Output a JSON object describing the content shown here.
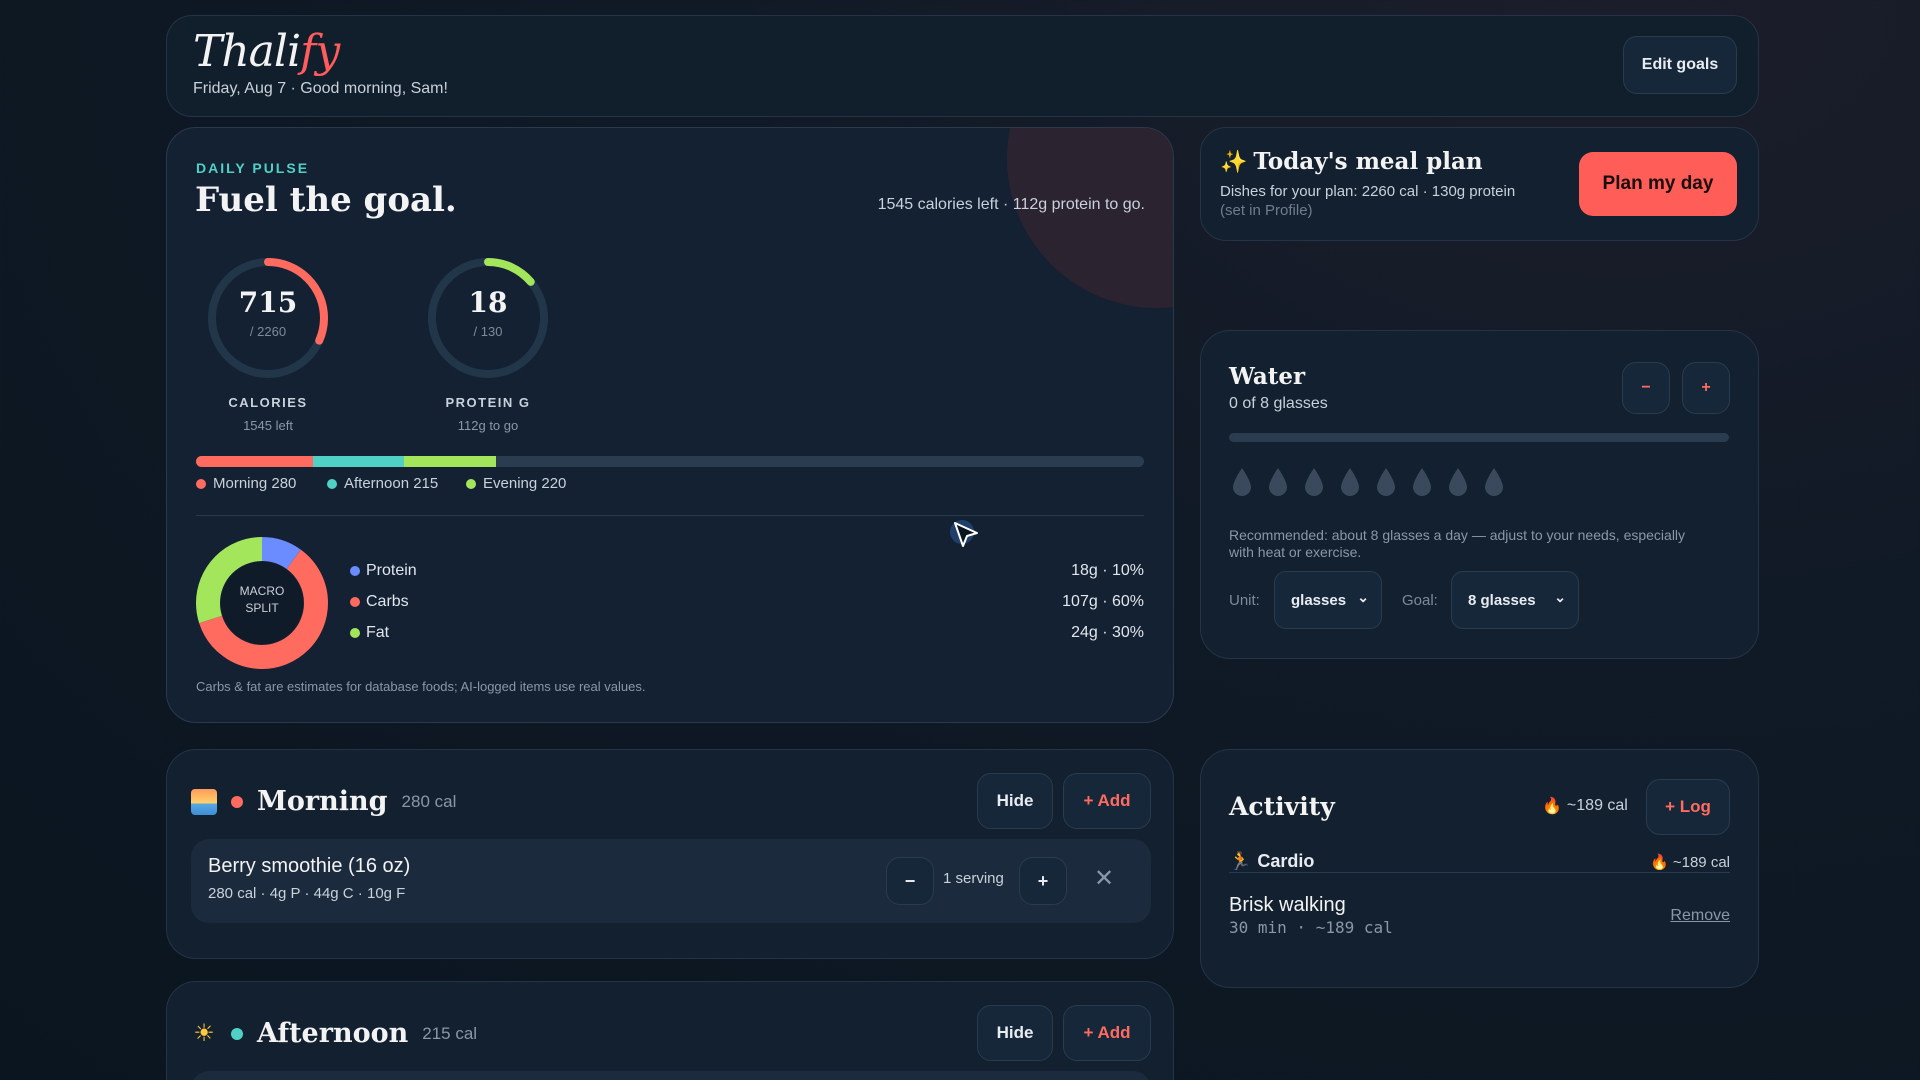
{
  "header": {
    "logo_main": "Thali",
    "logo_accent": "fy",
    "date_line": "Friday, Aug 7 · Good morning, Sam!",
    "edit_goals": "Edit goals"
  },
  "pulse": {
    "eyebrow": "DAILY PULSE",
    "title": "Fuel the goal.",
    "summary": "1545 calories left · 112g protein to go.",
    "calories": {
      "value": "715",
      "goal": "/ 2260",
      "label": "CALORIES",
      "note": "1545 left",
      "fraction": 0.316,
      "color": "#ff6b5f"
    },
    "protein": {
      "value": "18",
      "goal": "/ 130",
      "label": "PROTEIN G",
      "note": "112g to go",
      "fraction": 0.138,
      "color": "#a3e65b"
    },
    "progress": [
      {
        "name": "Morning",
        "value": 280,
        "label": "Morning 280",
        "color": "#ff6b5f"
      },
      {
        "name": "Afternoon",
        "value": 215,
        "label": "Afternoon 215",
        "color": "#4fd1c5"
      },
      {
        "name": "Evening",
        "value": 220,
        "label": "Evening 220",
        "color": "#a3e65b"
      }
    ],
    "progress_total": 2260,
    "macro_center_1": "MACRO",
    "macro_center_2": "SPLIT",
    "macros": [
      {
        "name": "Protein",
        "value": "18g · 10%",
        "pct": 10,
        "color": "#6b8cff"
      },
      {
        "name": "Carbs",
        "value": "107g · 60%",
        "pct": 60,
        "color": "#ff6b5f"
      },
      {
        "name": "Fat",
        "value": "24g · 30%",
        "pct": 30,
        "color": "#a3e65b"
      }
    ],
    "footnote": "Carbs & fat are estimates for database foods; AI-logged items use real values."
  },
  "meal_plan": {
    "icon": "sparkles-icon",
    "title": "Today's meal plan",
    "description": "Dishes for your plan: 2260 cal · 130g protein",
    "note": "(set in Profile)",
    "button": "Plan my day"
  },
  "water": {
    "title": "Water",
    "subtitle": "0 of 8 glasses",
    "minus": "−",
    "plus": "+",
    "fraction": 0,
    "glasses": 8,
    "recommendation": "Recommended: about 8 glasses a day — adjust to your needs, especially with heat or exercise.",
    "unit_label": "Unit:",
    "unit_value": "glasses",
    "goal_label": "Goal:",
    "goal_value": "8 glasses"
  },
  "activity": {
    "title": "Activity",
    "total": "~189 cal",
    "log_button": "+ Log",
    "category": "Cardio",
    "category_cal": "~189 cal",
    "item_name": "Brisk walking",
    "item_meta": "30 min · ~189 cal",
    "remove": "Remove"
  },
  "meals": {
    "morning": {
      "name": "Morning",
      "cal": "280 cal",
      "hide": "Hide",
      "add": "+ Add",
      "food_name": "Berry smoothie (16 oz)",
      "food_meta": "280 cal · 4g P · 44g C · 10g F",
      "qty": "1 serving",
      "minus": "−",
      "plus": "+",
      "remove": "✕"
    },
    "afternoon": {
      "name": "Afternoon",
      "cal": "215 cal",
      "hide": "Hide",
      "add": "+ Add"
    }
  }
}
